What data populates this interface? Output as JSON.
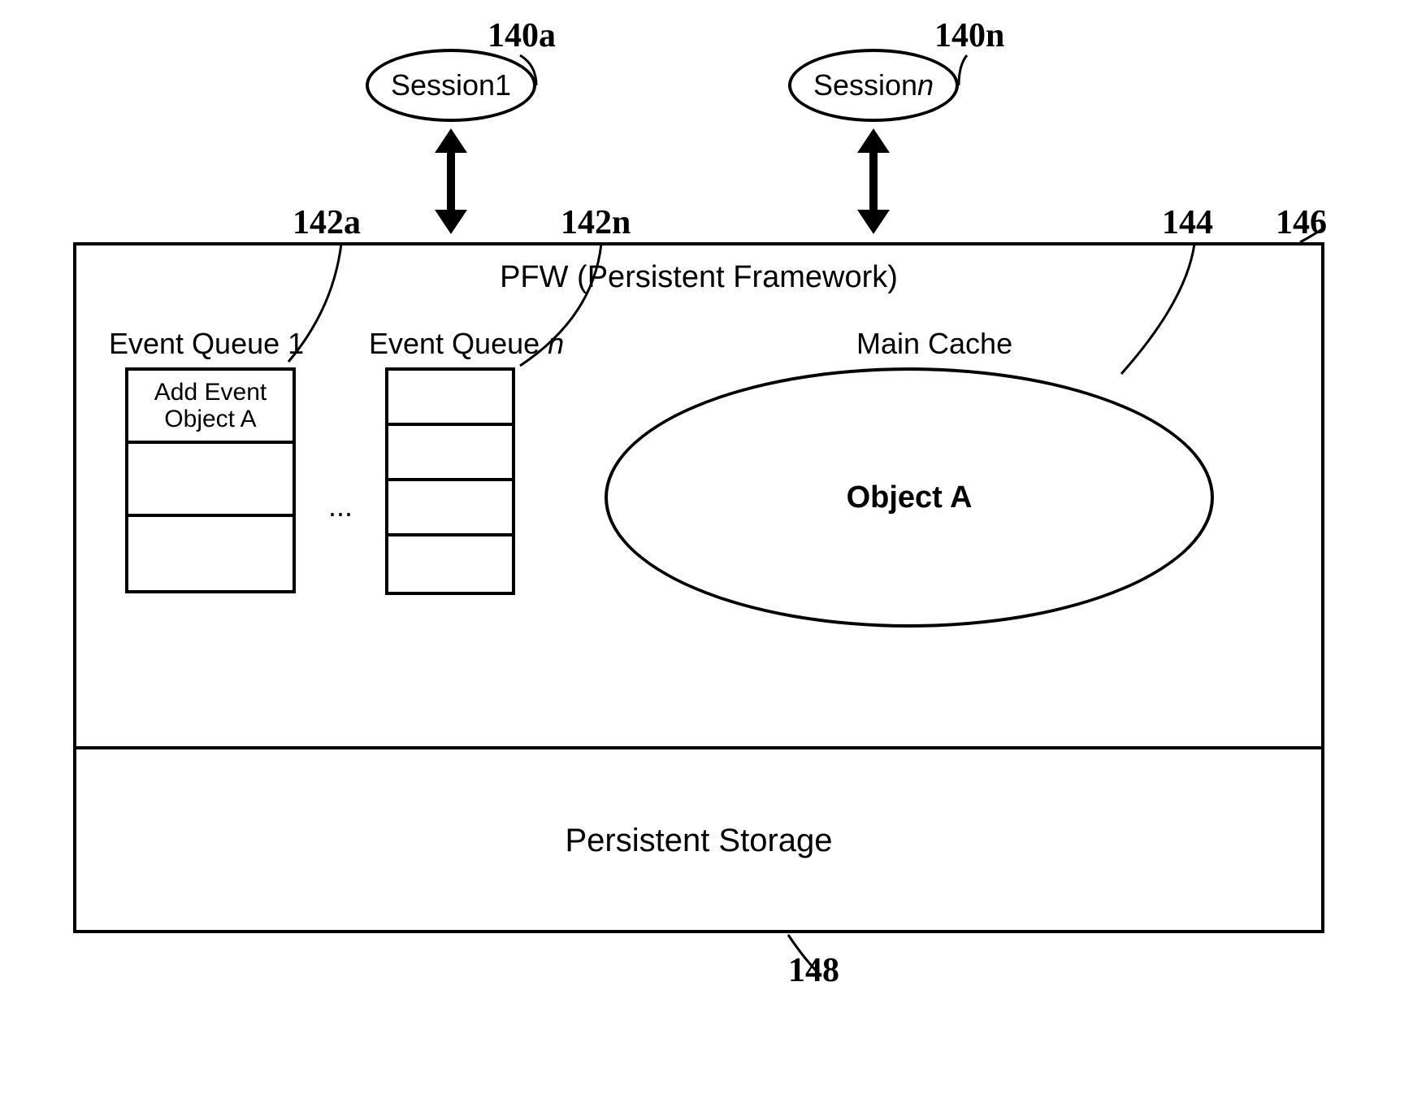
{
  "refs": {
    "r140a": "140a",
    "r140n": "140n",
    "r142a": "142a",
    "r142n": "142n",
    "r144": "144",
    "r146": "146",
    "r148": "148"
  },
  "sessions": {
    "s1_prefix": "Session ",
    "s1_num": "1",
    "sn_prefix": "Session ",
    "sn_num": "n"
  },
  "pfw_title": "PFW (Persistent Framework)",
  "event_queues": {
    "eq1_label_prefix": "Event Queue ",
    "eq1_label_num": "1",
    "eqn_label_prefix": "Event Queue ",
    "eqn_label_num": "n",
    "eq1_cell1_line1": "Add Event",
    "eq1_cell1_line2": "Object A",
    "ellipsis": "..."
  },
  "main_cache": {
    "label": "Main Cache",
    "object": "Object A"
  },
  "storage": {
    "label": "Persistent Storage"
  }
}
